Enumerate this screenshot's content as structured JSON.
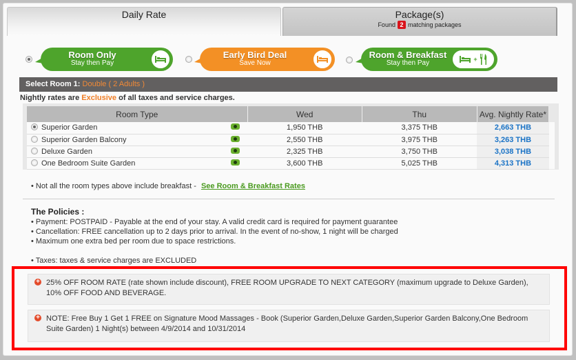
{
  "tabs": {
    "daily_rate": {
      "label": "Daily Rate"
    },
    "packages": {
      "label": "Package(s)",
      "found_prefix": "Found",
      "count": "2",
      "found_suffix": "matching packages"
    }
  },
  "rate_options": [
    {
      "title": "Room Only",
      "subtitle": "Stay then Pay",
      "color": "#4ea42c",
      "icon": "bed-icon",
      "selected": true
    },
    {
      "title": "Early Bird Deal",
      "subtitle": "Save Now",
      "color": "#f39025",
      "icon": "bed-icon",
      "selected": false
    },
    {
      "title": "Room & Breakfast",
      "subtitle": "Stay then Pay",
      "color": "#4ea42c",
      "icon": "bed-plus-fork-knife-icon",
      "icon_plus": "+",
      "selected": false
    }
  ],
  "select_room": {
    "label": "Select Room 1:",
    "value": "Double ( 2 Adults )"
  },
  "nightly_note": {
    "prefix": "Nightly rates are",
    "highlight": "Exclusive",
    "suffix": "of all taxes and service charges."
  },
  "rates_table": {
    "headers": [
      "Room Type",
      "Wed",
      "Thu",
      "Avg. Nightly Rate*"
    ],
    "rows": [
      {
        "room": "Superior Garden",
        "wed": "1,950 THB",
        "thu": "3,375 THB",
        "avg": "2,663 THB",
        "selected": true
      },
      {
        "room": "Superior Garden Balcony",
        "wed": "2,550 THB",
        "thu": "3,975 THB",
        "avg": "3,263 THB",
        "selected": false
      },
      {
        "room": "Deluxe Garden",
        "wed": "2,325 THB",
        "thu": "3,750 THB",
        "avg": "3,038 THB",
        "selected": false
      },
      {
        "room": "One Bedroom Suite Garden",
        "wed": "3,600 THB",
        "thu": "5,025 THB",
        "avg": "4,313 THB",
        "selected": false
      }
    ]
  },
  "breakfast_note": {
    "text": "• Not all the room types above include breakfast  -",
    "link": "See Room & Breakfast Rates"
  },
  "policies": {
    "title": "The Policies :",
    "items": [
      "• Payment: POSTPAID - Payable at the end of your stay. A valid credit card is required for payment guarantee",
      "• Cancellation: FREE cancellation up to 2 days prior to arrival. In the event of no-show, 1 night will be charged",
      "• Maximum one extra bed per room due to space restrictions.",
      "• Taxes: taxes & service charges are EXCLUDED"
    ]
  },
  "promotions": [
    "25% OFF ROOM RATE (rate shown include discount), FREE ROOM UPGRADE TO NEXT CATEGORY (maximum upgrade to Deluxe Garden), 10% OFF FOOD AND BEVERAGE.",
    "NOTE: Free Buy 1 Get 1 FREE on Signature Mood Massages - Book (Superior Garden,Deluxe Garden,Superior Garden Balcony,One Bedroom Suite Garden) 1 Night(s) between 4/9/2014 and 10/31/2014"
  ],
  "colors": {
    "green": "#4ea42c",
    "orange": "#f39025",
    "link_blue": "#1a73c6",
    "highlight_red": "#ff0000"
  }
}
